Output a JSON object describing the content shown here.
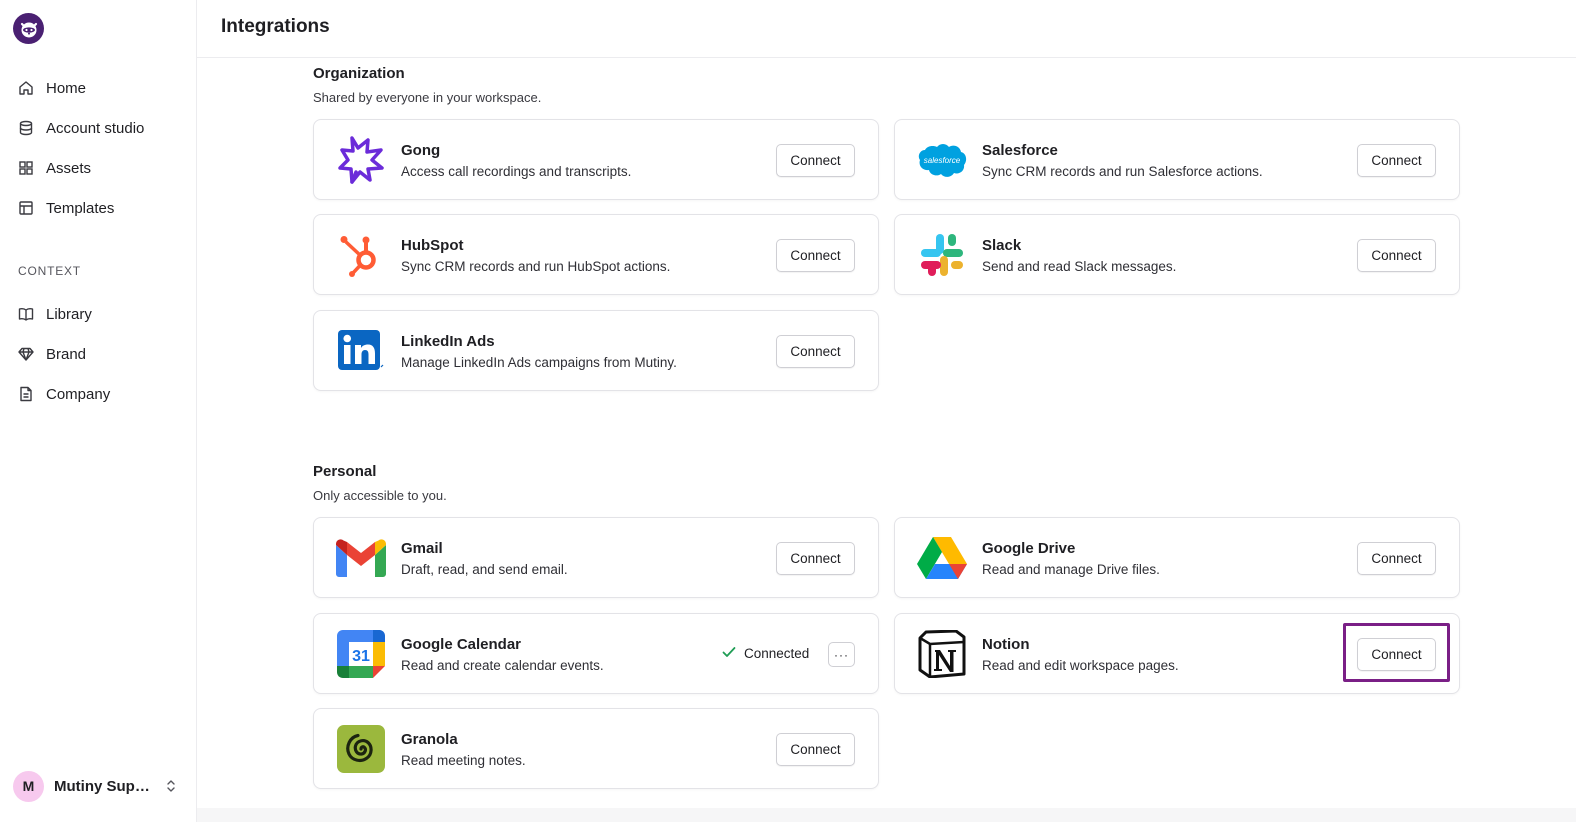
{
  "sidebar": {
    "nav": [
      {
        "label": "Home",
        "icon": "home-icon"
      },
      {
        "label": "Account studio",
        "icon": "database-icon"
      },
      {
        "label": "Assets",
        "icon": "grid-icon"
      },
      {
        "label": "Templates",
        "icon": "layout-icon"
      }
    ],
    "context_heading": "CONTEXT",
    "context": [
      {
        "label": "Library",
        "icon": "book-icon"
      },
      {
        "label": "Brand",
        "icon": "diamond-icon"
      },
      {
        "label": "Company",
        "icon": "document-icon"
      }
    ],
    "user": {
      "initial": "M",
      "name": "Mutiny Support"
    }
  },
  "header": {
    "title": "Integrations"
  },
  "organization": {
    "title": "Organization",
    "subtitle": "Shared by everyone in your workspace.",
    "items": [
      {
        "name": "Gong",
        "desc": "Access call recordings and transcripts.",
        "action": "Connect"
      },
      {
        "name": "Salesforce",
        "desc": "Sync CRM records and run Salesforce actions.",
        "action": "Connect",
        "logo_text": "salesforce"
      },
      {
        "name": "HubSpot",
        "desc": "Sync CRM records and run HubSpot actions.",
        "action": "Connect"
      },
      {
        "name": "Slack",
        "desc": "Send and read Slack messages.",
        "action": "Connect"
      },
      {
        "name": "LinkedIn Ads",
        "desc": "Manage LinkedIn Ads campaigns from Mutiny.",
        "action": "Connect"
      }
    ]
  },
  "personal": {
    "title": "Personal",
    "subtitle": "Only accessible to you.",
    "items": [
      {
        "name": "Gmail",
        "desc": "Draft, read, and send email.",
        "action": "Connect"
      },
      {
        "name": "Google Drive",
        "desc": "Read and manage Drive files.",
        "action": "Connect"
      },
      {
        "name": "Google Calendar",
        "desc": "Read and create calendar events.",
        "status": "Connected",
        "more": "···",
        "logo_text": "31"
      },
      {
        "name": "Notion",
        "desc": "Read and edit workspace pages.",
        "action": "Connect"
      },
      {
        "name": "Granola",
        "desc": "Read meeting notes.",
        "action": "Connect"
      }
    ]
  },
  "colors": {
    "accent": "#7a1f86",
    "brand": "#4a2072",
    "connected": "#1f9d55"
  }
}
